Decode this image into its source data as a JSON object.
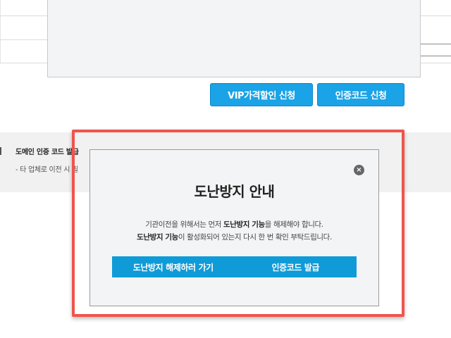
{
  "buttons": {
    "vip_label": "VIP가격할인 신청",
    "auth_label": "인증코드 신청"
  },
  "section": {
    "title": "도메인 인증 코드 발급",
    "desc": "- 타 업체로 이전 시 필"
  },
  "modal": {
    "close_glyph": "×",
    "title": "도난방지 안내",
    "line1_a": "기관이전을 위해서는 먼저 ",
    "line1_b": "도난방지 기능",
    "line1_c": "을 해제해야 합니다.",
    "line2_a": "도난방지 기능",
    "line2_b": "이 활성화되어 있는지 다시 한 번 확인 부탁드립니다.",
    "btn_release": "도난방지 해제하러 가기",
    "btn_issue": "인증코드 발급"
  },
  "colors": {
    "accent": "#1aa3e6",
    "highlight": "#f0544c"
  }
}
